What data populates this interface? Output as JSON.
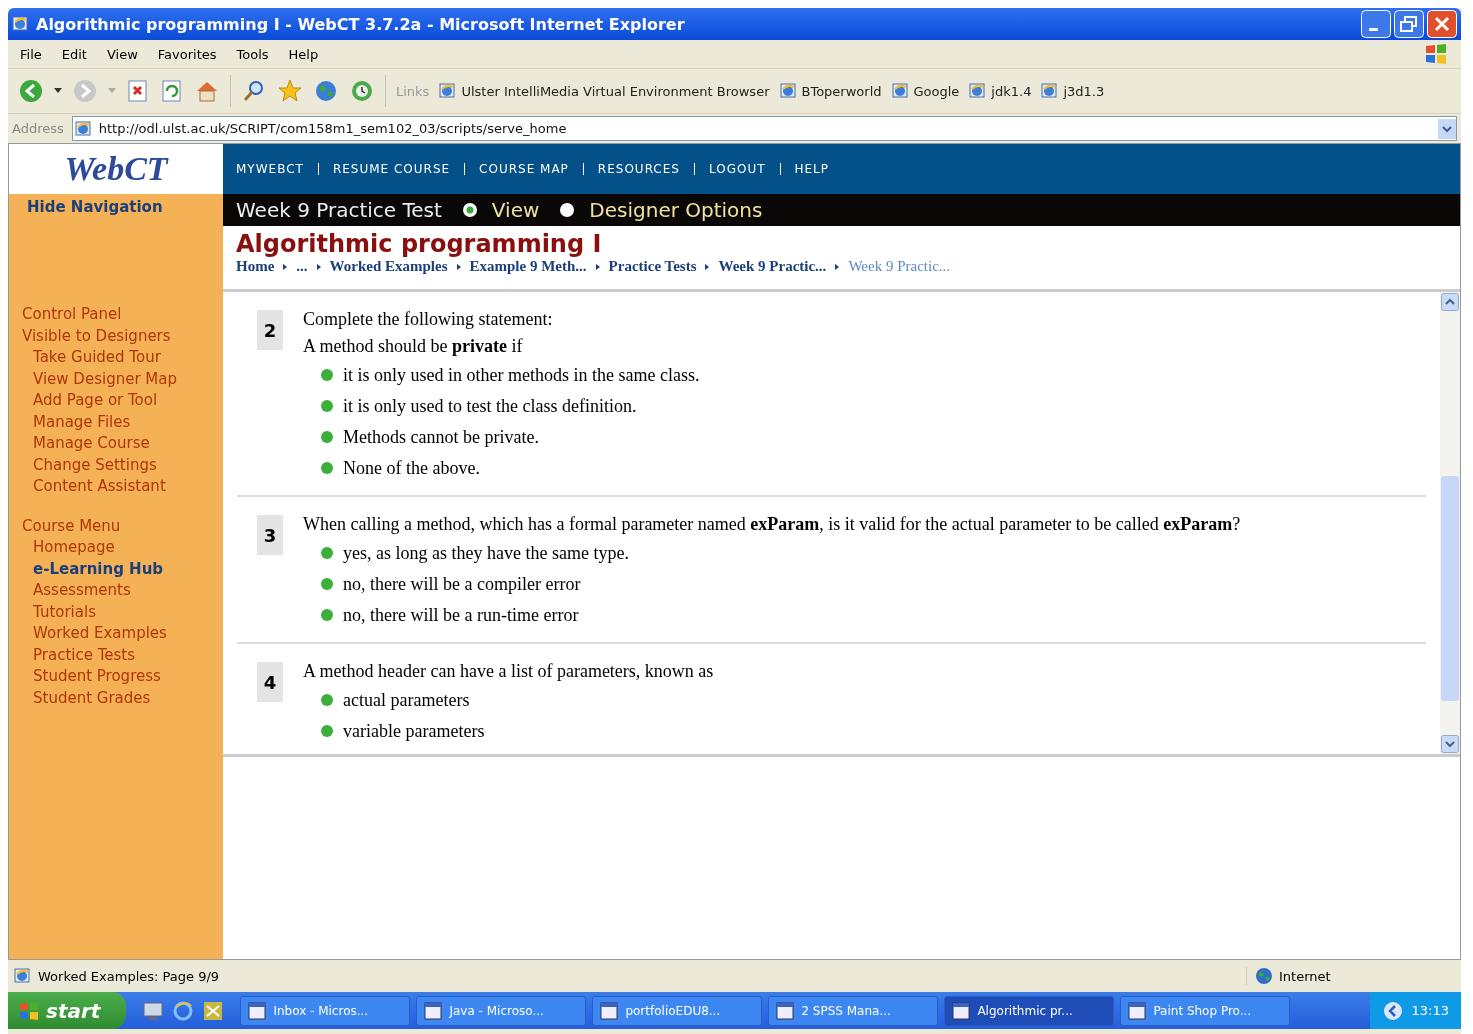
{
  "window": {
    "title": "Algorithmic programming I - WebCT 3.7.2a - Microsoft Internet Explorer"
  },
  "menu_bar": [
    "File",
    "Edit",
    "View",
    "Favorites",
    "Tools",
    "Help"
  ],
  "links_bar": {
    "label": "Links",
    "links": [
      "Ulster IntelliMedia Virtual Environment Browser",
      "BToperworld",
      "Google",
      "jdk1.4",
      "j3d1.3"
    ]
  },
  "address_bar": {
    "label": "Address",
    "value": "http://odl.ulst.ac.uk/SCRIPT/com158m1_sem102_03/scripts/serve_home"
  },
  "webct": {
    "logo": "WebCT",
    "hide_navigation": "Hide Navigation",
    "top_nav": [
      "MYWEBCT",
      "RESUME COURSE",
      "COURSE MAP",
      "RESOURCES",
      "LOGOUT",
      "HELP"
    ],
    "page_title": "Week 9 Practice Test",
    "modes": [
      {
        "label": "View",
        "selected": true
      },
      {
        "label": "Designer Options",
        "selected": false
      }
    ],
    "course_title": "Algorithmic programming I",
    "breadcrumb": [
      {
        "label": "Home",
        "current": false
      },
      {
        "label": "...",
        "current": false
      },
      {
        "label": "Worked Examples",
        "current": false
      },
      {
        "label": "Example 9 Meth...",
        "current": false
      },
      {
        "label": "Practice Tests",
        "current": false
      },
      {
        "label": "Week 9 Practic...",
        "current": false
      },
      {
        "label": "Week 9 Practic...",
        "current": true
      }
    ],
    "sidebar": [
      {
        "headings": [
          "Control Panel",
          "Visible to Designers"
        ],
        "items": [
          {
            "label": "Take Guided Tour",
            "selected": false
          },
          {
            "label": "View Designer Map",
            "selected": false
          },
          {
            "label": "Add Page or Tool",
            "selected": false
          },
          {
            "label": "Manage Files",
            "selected": false
          },
          {
            "label": "Manage Course",
            "selected": false
          },
          {
            "label": "Change Settings",
            "selected": false
          },
          {
            "label": "Content Assistant",
            "selected": false
          }
        ]
      },
      {
        "headings": [
          "Course Menu"
        ],
        "items": [
          {
            "label": "Homepage",
            "selected": false
          },
          {
            "label": "e-Learning Hub",
            "selected": true
          },
          {
            "label": "Assessments",
            "selected": false
          },
          {
            "label": "Tutorials",
            "selected": false
          },
          {
            "label": "Worked Examples",
            "selected": false
          },
          {
            "label": "Practice Tests",
            "selected": false
          },
          {
            "label": "Student Progress",
            "selected": false
          },
          {
            "label": "Student Grades",
            "selected": false
          }
        ]
      }
    ],
    "questions": [
      {
        "number": "2",
        "prompt": [
          "Complete the following statement:",
          "A method should be **private** if"
        ],
        "options": [
          "it is only used in other methods in the same class.",
          "it is only used to test the class definition.",
          "Methods cannot be private.",
          "None of the above."
        ]
      },
      {
        "number": "3",
        "prompt": [
          "When calling a method, which has a formal parameter named **exParam**, is it valid for the actual parameter to be called **exParam**?"
        ],
        "options": [
          "yes, as long as they have the same type.",
          "no, there will be a compiler error",
          "no, there will be a run-time error"
        ]
      },
      {
        "number": "4",
        "prompt": [
          "A method header can have a list of parameters, known as"
        ],
        "options": [
          "actual parameters",
          "variable parameters"
        ]
      }
    ]
  },
  "status_bar": {
    "text": "Worked Examples:  Page 9/9",
    "zone": "Internet"
  },
  "taskbar": {
    "start": "start",
    "tasks": [
      {
        "label": "Inbox - Micros...",
        "selected": false
      },
      {
        "label": "Java - Microso...",
        "selected": false
      },
      {
        "label": "portfolioEDU8...",
        "selected": false
      },
      {
        "label": "2 SPSS Mana...",
        "selected": false
      },
      {
        "label": "Algorithmic pr...",
        "selected": true
      },
      {
        "label": "Paint Shop Pro...",
        "selected": false
      }
    ],
    "clock": "13:13"
  }
}
